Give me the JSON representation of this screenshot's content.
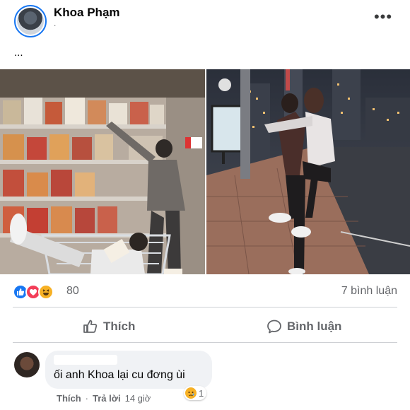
{
  "post": {
    "author": "Khoa Phạm",
    "subline": ".",
    "more_label": "•••",
    "caption": "..."
  },
  "stats": {
    "reaction_count": "80",
    "comment_count": "7 bình luận",
    "reactions": [
      "like-icon",
      "love-icon",
      "haha-icon"
    ]
  },
  "actions": {
    "like_label": "Thích",
    "comment_label": "Bình luận"
  },
  "comment": {
    "text": "ối anh Khoa lại cu đơng ùi",
    "reaction_count": "1",
    "like_label": "Thích",
    "reply_label": "Trả lời",
    "time": "14 giờ"
  },
  "colors": {
    "accent": "#1877f2",
    "secondary_text": "#65676b",
    "bubble": "#f0f2f5"
  }
}
